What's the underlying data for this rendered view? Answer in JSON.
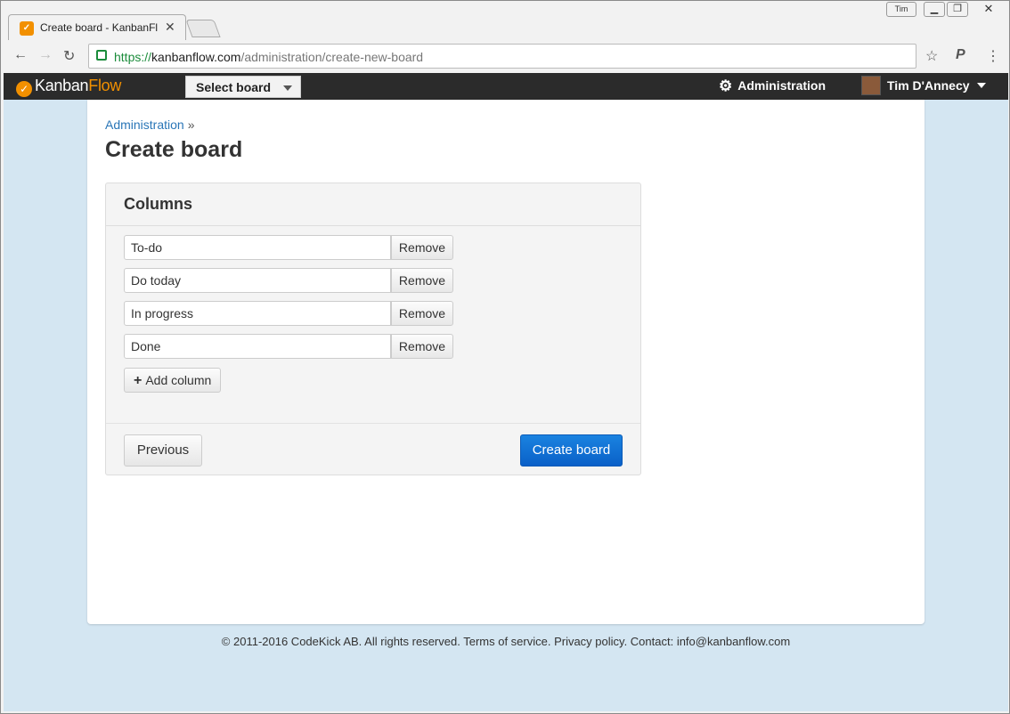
{
  "browser": {
    "tab_title": "Create board - KanbanFl",
    "tab_favicon": "kanbanflow-favicon",
    "window_user": "Tim",
    "url_protocol": "https://",
    "url_host": "kanbanflow.com",
    "url_path": "/administration/create-new-board"
  },
  "appbar": {
    "logo_kanban": "Kanban",
    "logo_flow": "Flow",
    "board_select_label": "Select board",
    "admin_label": "Administration",
    "user_name": "Tim D'Annecy"
  },
  "page": {
    "breadcrumb_link": "Administration",
    "breadcrumb_sep": "»",
    "title": "Create board"
  },
  "columns_panel": {
    "heading": "Columns",
    "columns": [
      {
        "value": "To-do",
        "remove_label": "Remove"
      },
      {
        "value": "Do today",
        "remove_label": "Remove"
      },
      {
        "value": "In progress",
        "remove_label": "Remove"
      },
      {
        "value": "Done",
        "remove_label": "Remove"
      }
    ],
    "add_label": "Add column",
    "previous_label": "Previous",
    "create_label": "Create board"
  },
  "footer": {
    "text": "© 2011-2016 CodeKick AB. All rights reserved. Terms of service. Privacy policy. Contact: info@kanbanflow.com"
  },
  "colors": {
    "accent": "#f29000",
    "primary_button": "#0a60c8",
    "link": "#2a76b7",
    "background": "#d4e6f2"
  }
}
